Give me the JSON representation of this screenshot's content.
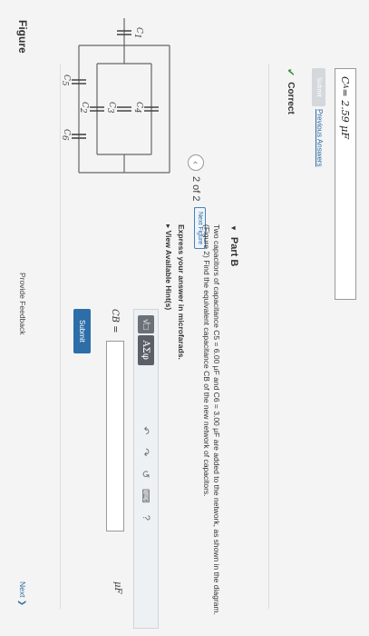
{
  "figure": {
    "title": "Figure",
    "pager_text": "2 of 2",
    "next_figure_label": "Next Figure",
    "capacitor_labels": {
      "c1": "C",
      "c1_sub": "1",
      "c2": "C",
      "c2_sub": "2",
      "c3": "C",
      "c3_sub": "3",
      "c4": "C",
      "c4_sub": "4",
      "c5": "C",
      "c5_sub": "5",
      "c6": "C",
      "c6_sub": "6"
    }
  },
  "part_a": {
    "answer_label": "C",
    "answer_sub": "A",
    "answer_value": " = 2.59  μF",
    "submit_label": "Submit",
    "previous_answers": "Previous Answers",
    "status": "Correct"
  },
  "part_b": {
    "title": "Part B",
    "question": "Two capacitors of capacitance C5 = 6.00 μF and C6 = 3.00 μF are added to the network, as shown in the diagram.(Figure 2) Find the equivalent capacitance CB of the new network of capacitors.",
    "instruction": "Express your answer in microfarads.",
    "hint_link": "View Available Hint(s)",
    "toolbar": {
      "templates_label": "√□",
      "symbols_label": "AΣφ",
      "undo_icon": "↶",
      "redo_icon": "↷",
      "reset_icon": "↺",
      "keyboard_icon": "⌨",
      "help_icon": "?"
    },
    "input_label": "CB =",
    "unit": "μF",
    "submit_label": "Submit"
  },
  "footer": {
    "feedback": "Provide Feedback",
    "next": "Next ❯"
  }
}
